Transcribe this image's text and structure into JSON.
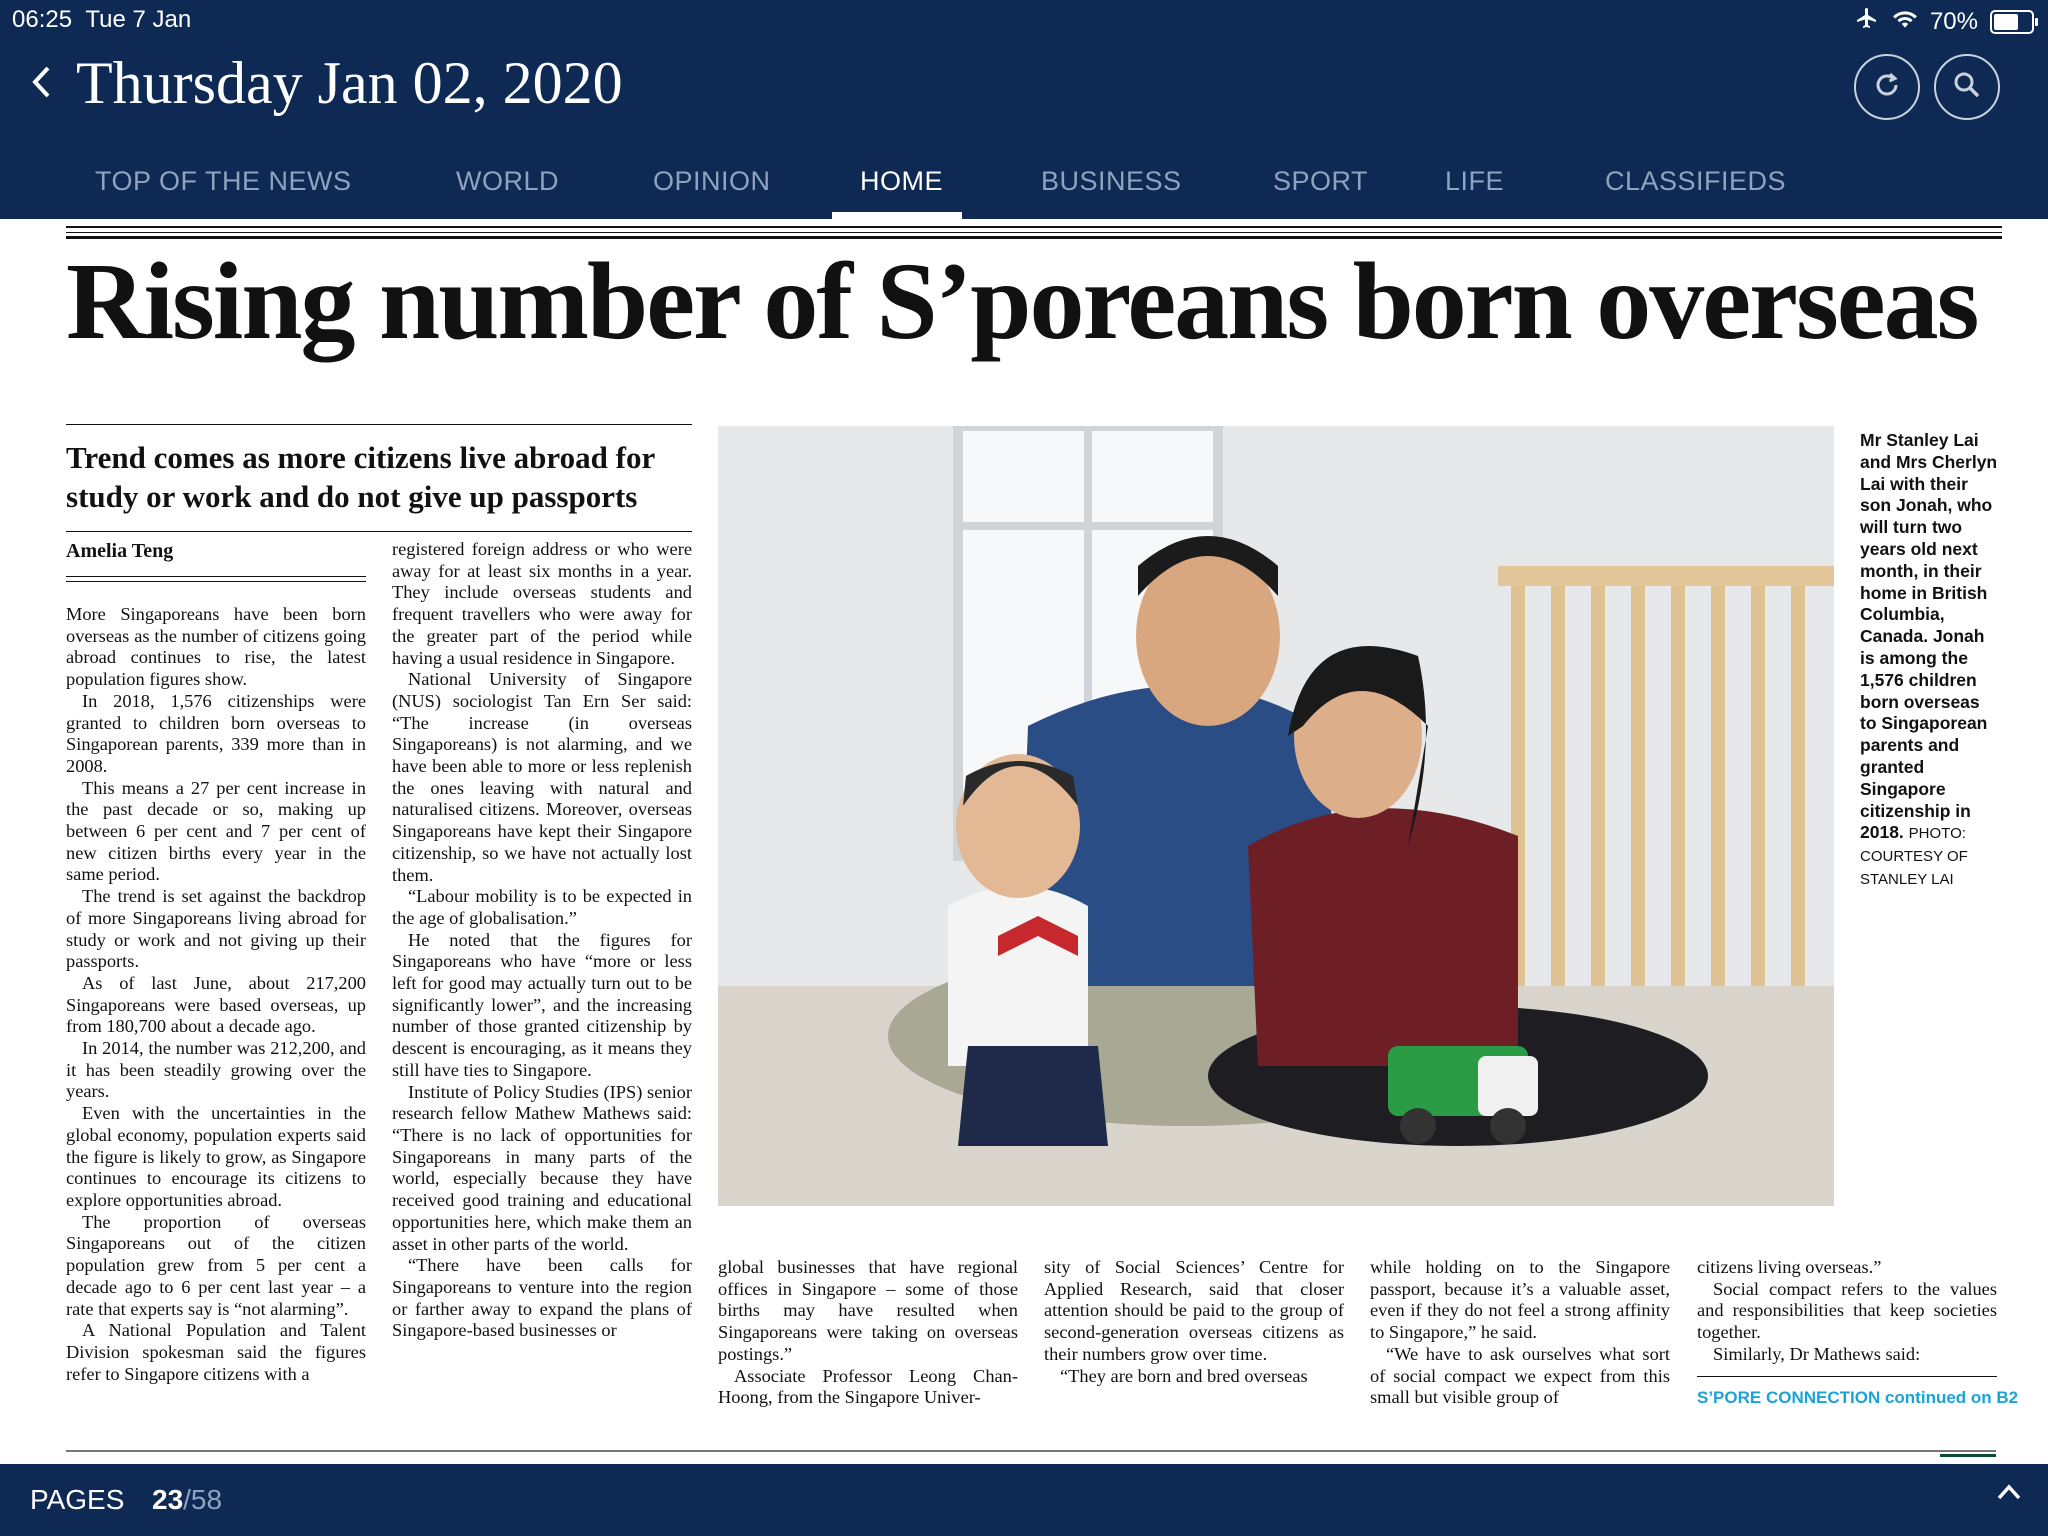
{
  "status": {
    "time": "06:25",
    "date": "Tue 7 Jan",
    "battery": "70%",
    "battery_level": 0.7
  },
  "header": {
    "date_title": "Thursday Jan 02, 2020",
    "refresh_icon": "refresh-icon",
    "search_icon": "search-icon",
    "back_icon": "chevron-left-icon"
  },
  "tabs": [
    {
      "label": "TOP OF THE NEWS"
    },
    {
      "label": "WORLD"
    },
    {
      "label": "OPINION"
    },
    {
      "label": "HOME"
    },
    {
      "label": "BUSINESS"
    },
    {
      "label": "SPORT"
    },
    {
      "label": "LIFE"
    },
    {
      "label": "CLASSIFIEDS"
    }
  ],
  "active_tab": "HOME",
  "article": {
    "headline": "Rising number of S’poreans born overseas",
    "subhead": "Trend comes as more citizens live abroad for study or work and do not give up passports",
    "byline": "Amelia Teng",
    "col1": [
      "More Singaporeans have been born overseas as the number of citizens going abroad continues to rise, the latest population figures show.",
      "In 2018, 1,576 citizenships were granted to children born overseas to Singaporean parents, 339 more than in 2008.",
      "This means a 27 per cent increase in the past decade or so, making up between 6 per cent and 7 per cent of new citizen births every year in the same period.",
      "The trend is set against the backdrop of more Singaporeans living abroad for study or work and not giving up their passports.",
      "As of last June, about 217,200 Singaporeans were based overseas, up from 180,700 about a decade ago.",
      "In 2014, the number was 212,200, and it has been steadily growing over the years.",
      "Even with the uncertainties in the global economy, population experts said the figure is likely to grow, as Singapore continues to encourage its citizens to explore opportunities abroad.",
      "The proportion of overseas Singaporeans out of the citizen population grew from 5 per cent a decade ago to 6 per cent last year – a rate that experts say is “not alarming”.",
      "A National Population and Talent Division spokesman said the figures refer to Singapore citizens with a"
    ],
    "col2": [
      "registered foreign address or who were away for at least six months in a year. They include overseas students and frequent travellers who were away for the greater part of the period while having a usual residence in Singapore.",
      "National University of Singapore (NUS) sociologist Tan Ern Ser said: “The increase (in overseas Singaporeans) is not alarming, and we have been able to more or less replenish the ones leaving with natural and naturalised citizens. Moreover, overseas Singaporeans have kept their Singapore citizenship, so we have not actually lost them.",
      "“Labour mobility is to be expected in the age of globalisation.”",
      "He noted that the figures for Singaporeans who have “more or less left for good may actually turn out to be significantly lower”, and the increasing number of those granted citizenship by descent is encouraging, as it means they still have ties to Singapore.",
      "Institute of Policy Studies (IPS) senior research fellow Mathew Mathews said: “There is no lack of opportunities for Singaporeans in many parts of the world, especially because they have received good training and educational opportunities here, which make them an asset in other parts of the world.",
      "“There have been calls for Singaporeans to venture into the region or farther away to expand the plans of Singapore-based businesses or"
    ],
    "col3": [
      "global businesses that have regional offices in Singapore – some of those births may have resulted when Singaporeans were taking on overseas postings.”",
      "Associate Professor Leong Chan-Hoong, from the Singapore Univer-"
    ],
    "col4": [
      "sity of Social Sciences’ Centre for Applied Research, said that closer attention should be paid to the group of second-generation overseas citizens as their numbers grow over time.",
      "“They are born and bred overseas"
    ],
    "col5": [
      "while holding on to the Singapore passport, because it’s a valuable asset, even if they do not feel a strong affinity to Singapore,” he said.",
      "“We have to ask ourselves what sort of social compact we expect from this small but visible group of"
    ],
    "col6": [
      "citizens living overseas.”",
      "Social compact refers to the values and responsibilities that keep societies together.",
      "Similarly, Dr Mathews said:"
    ],
    "continued": "S’PORE CONNECTION continued on B2",
    "caption": "Mr Stanley Lai and Mrs Cherlyn Lai with their son Jonah, who will turn two years old next month, in their home in British Columbia, Canada. Jonah is among the 1,576 children born overseas to Singaporean parents and granted Singapore citizenship in 2018.",
    "caption_credit": "PHOTO: COURTESY OF STANLEY LAI"
  },
  "footer": {
    "pages_label": "PAGES",
    "current_page": "23",
    "total_pages": "/58",
    "up_icon": "chevron-up-icon"
  }
}
